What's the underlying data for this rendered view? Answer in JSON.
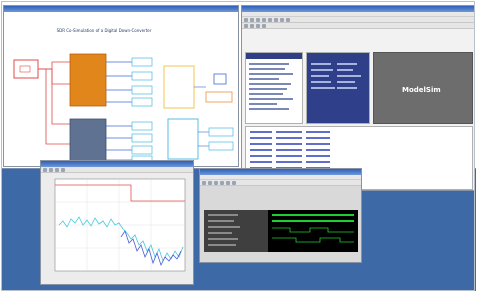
{
  "model_window": {
    "title": "SDR Co-Simulation of a Digital Down-Converter"
  },
  "config_window": {
    "brand": "ModelSim"
  },
  "plot_window": {},
  "logic_window": {},
  "colors": {
    "desktop": "#3d6aa6",
    "titlebar": "#2f5fb8",
    "block_orange": "#e0861a",
    "block_slate": "#5f7291",
    "signal_red": "#e04848",
    "waveform_green": "#1fcf2f",
    "plot_cyan": "#46c8e0",
    "plot_blue": "#4a5ad8"
  }
}
